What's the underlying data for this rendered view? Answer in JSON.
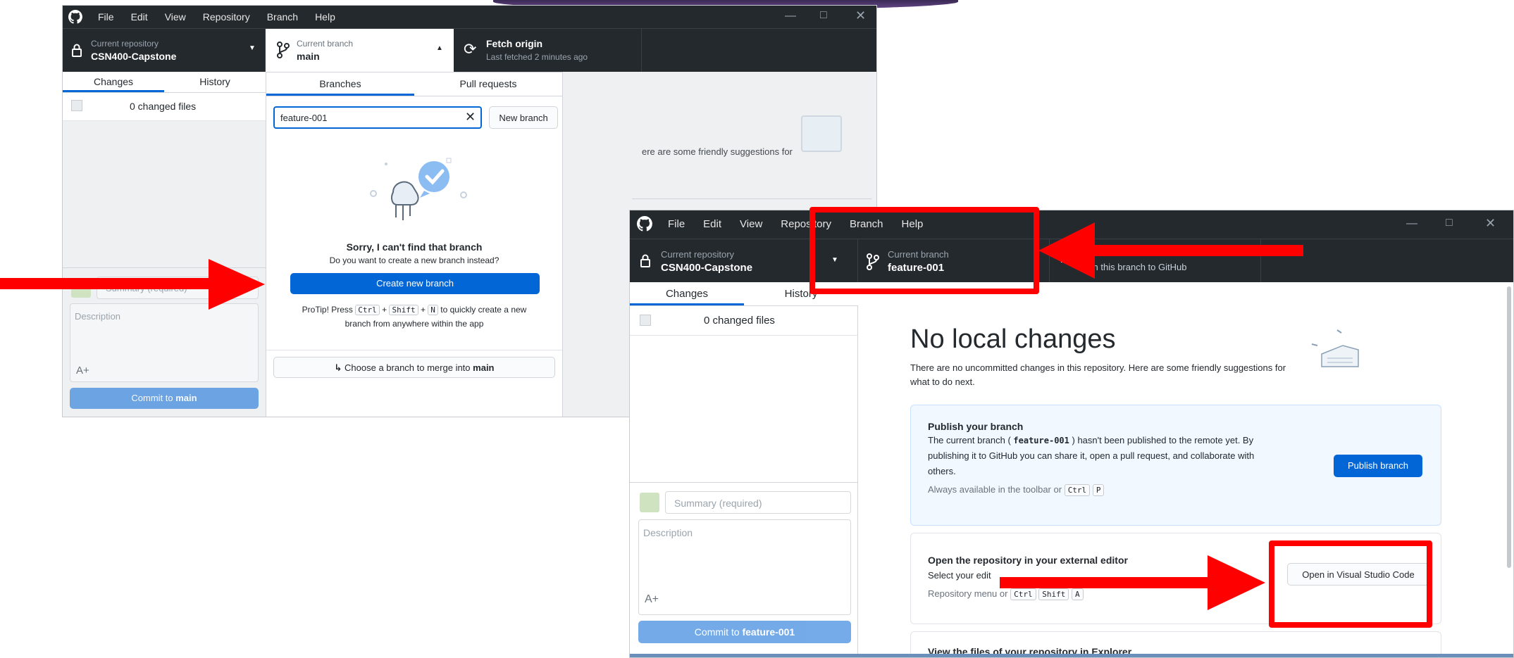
{
  "menu": [
    "File",
    "Edit",
    "View",
    "Repository",
    "Branch",
    "Help"
  ],
  "repo": {
    "label": "Current repository",
    "name": "CSN400-Capstone"
  },
  "win1": {
    "branch_label": "Current branch",
    "branch_name": "main",
    "fetch_title": "Fetch origin",
    "fetch_sub": "Last fetched 2 minutes ago",
    "tab_changes": "Changes",
    "tab_history": "History",
    "changed_files": "0 changed files",
    "summary_placeholder": "Summary (required)",
    "description_placeholder": "Description",
    "commit_prefix": "Commit to ",
    "commit_branch": "main",
    "bg_suggest": "ere are some friendly suggestions for",
    "bg_partial": "er",
    "dropdown": {
      "tab_branches": "Branches",
      "tab_pull": "Pull requests",
      "search_value": "feature-001",
      "new_branch": "New branch",
      "sorry_title": "Sorry, I can't find that branch",
      "sorry_sub": "Do you want to create a new branch instead?",
      "create_button": "Create new branch",
      "protip_a": "ProTip! Press",
      "key1": "Ctrl",
      "plus": "+",
      "key2": "Shift",
      "key3": "N",
      "protip_b": "to quickly create a new",
      "protip_c": "branch from anywhere within the app",
      "merge_text": "Choose a branch to merge into",
      "merge_branch": "main"
    }
  },
  "win2": {
    "branch_label": "Current branch",
    "branch_name": "feature-001",
    "publish_toolbar": "blish this branch to GitHub",
    "tab_changes": "Changes",
    "tab_history": "History",
    "changed_files": "0 changed files",
    "summary_placeholder": "Summary (required)",
    "description_placeholder": "Description",
    "commit_prefix": "Commit to ",
    "commit_branch": "feature-001",
    "no_changes_title": "No local changes",
    "no_changes_sub1": "There are no uncommitted changes in this repository. Here are some friendly suggestions for",
    "no_changes_sub2": "what to do next.",
    "publish_card": {
      "title": "Publish your branch",
      "line1a": "The current branch (",
      "line1b": "feature-001",
      "line1c": ") hasn't been published to the remote yet. By",
      "line2": "publishing it to GitHub you can share it, open a pull request, and collaborate with",
      "line3": "others.",
      "hint": "Always available in the toolbar or",
      "k1": "Ctrl",
      "k2": "P",
      "button": "Publish branch"
    },
    "editor_card": {
      "title": "Open the repository in your external editor",
      "line1": "Select your edit",
      "hint": "Repository menu or",
      "k1": "Ctrl",
      "k2": "Shift",
      "k3": "A",
      "button": "Open in Visual Studio Code"
    },
    "explorer_title": "View the files of your repository in Explorer"
  },
  "colors": {
    "annotation": "#ff0000",
    "accent": "#0366d6",
    "titlebar": "#24292e"
  }
}
